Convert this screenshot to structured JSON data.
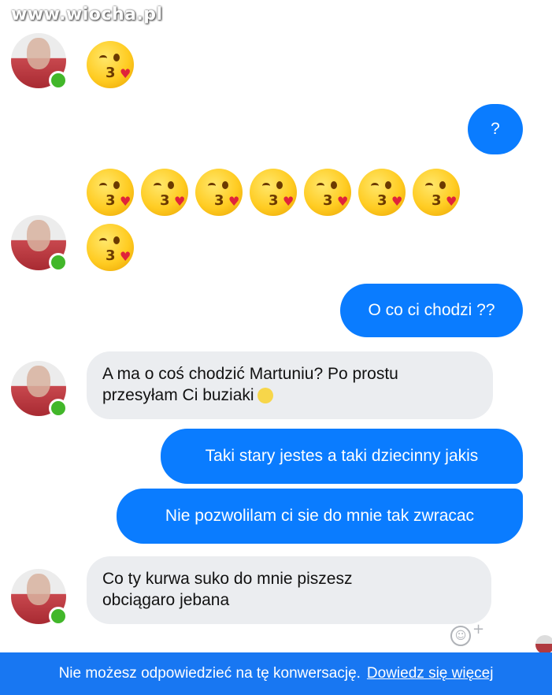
{
  "watermark": "www.wiocha.pl",
  "colors": {
    "outgoing_bubble": "#0a7cff",
    "incoming_bubble": "#ebedf0",
    "online": "#42b72a",
    "footer": "#1877f2"
  },
  "messages": {
    "question": "?",
    "what_about": "O co ci chodzi ??",
    "reply1_line1": "A ma o coś chodzić Martuniu? Po prostu",
    "reply1_line2": "przesyłam Ci buziaki",
    "out1": "Taki stary jestes a taki dziecinny jakis",
    "out2": "Nie pozwolilam ci sie do mnie tak zwracac",
    "reply2_line1": "Co ty kurwa suko do mnie piszesz",
    "reply2_line2": "obciągaro jebana"
  },
  "emoji_name": "face-blowing-a-kiss",
  "footer": {
    "notice": "Nie możesz odpowiedzieć na tę konwersację.",
    "link": "Dowiedz się więcej"
  }
}
